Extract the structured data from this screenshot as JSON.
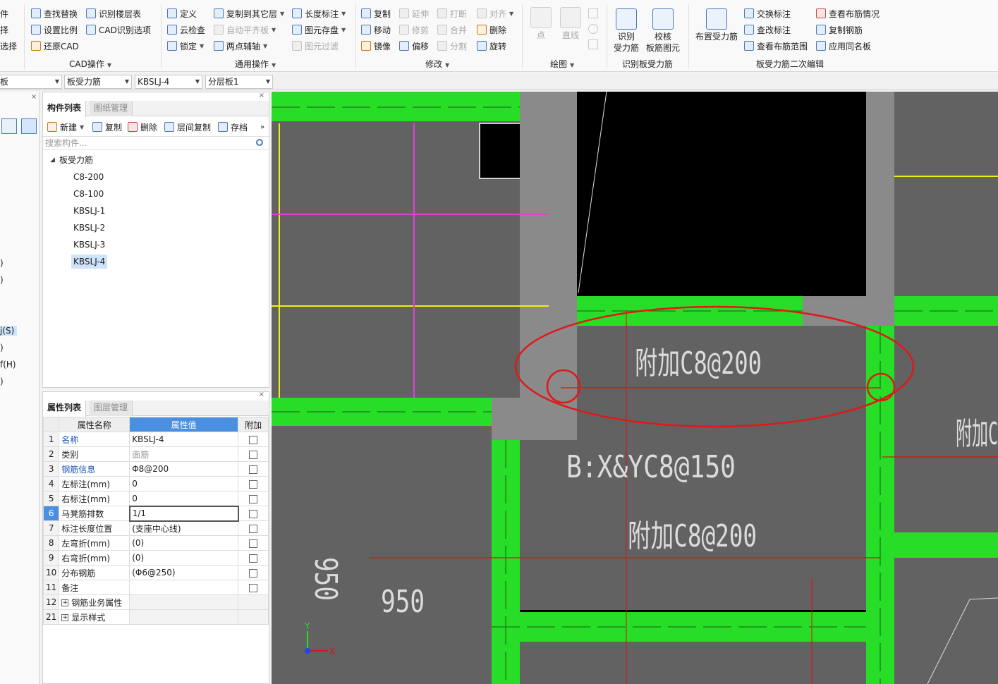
{
  "ribbon": {
    "cad": {
      "label": "CAD操作",
      "find_replace": "查找替换",
      "recognize_floor_table": "识别楼层表",
      "set_scale": "设置比例",
      "cad_options": "CAD识别选项",
      "restore_cad": "还原CAD"
    },
    "general": {
      "label": "通用操作",
      "define": "定义",
      "copy_to_other_floor": "复制到其它层",
      "length_mark": "长度标注",
      "cloud_check": "云检查",
      "auto_flat_slab": "自动平齐板",
      "element_save": "图元存盘",
      "lock": "锁定",
      "two_point_axis": "两点辅轴",
      "element_filter": "图元过滤"
    },
    "modify": {
      "label": "修改",
      "copy": "复制",
      "extend": "延伸",
      "break": "打断",
      "align": "对齐",
      "move": "移动",
      "trim": "修剪",
      "merge": "合并",
      "delete": "删除",
      "mirror": "镜像",
      "offset": "偏移",
      "split": "分割",
      "rotate": "旋转"
    },
    "draw": {
      "label": "绘图",
      "point": "点",
      "line": "直线"
    },
    "recognize": {
      "label": "识别板受力筋",
      "recognize_rebar_1": "识别",
      "recognize_rebar_2": "受力筋",
      "check_slab_1": "校核",
      "check_slab_2": "板筋图元"
    },
    "secondary": {
      "label": "板受力筋二次编辑",
      "place_rebar": "布置受力筋",
      "swap_mark": "交换标注",
      "view_layout": "查看布筋情况",
      "view_mark": "查改标注",
      "copy_rebar": "复制钢筋",
      "view_range": "查看布筋范围",
      "apply_same_name": "应用同名板"
    },
    "left_cut": [
      "件",
      "择",
      "选择"
    ]
  },
  "selectors": {
    "s0": "板",
    "s1": "板受力筋",
    "s2": "KBSLJ-4",
    "s3": "分层板1"
  },
  "leftnav": {
    "items": [
      ")",
      ")",
      "j(S)",
      ")",
      "f(H)",
      ")"
    ]
  },
  "components": {
    "tabs": {
      "list": "构件列表",
      "drawings": "图纸管理"
    },
    "toolbar": {
      "new": "新建",
      "copy": "复制",
      "delete": "删除",
      "floor_copy": "层间复制",
      "archive": "存档"
    },
    "search_placeholder": "搜索构件...",
    "tree": {
      "root": "板受力筋",
      "items": [
        "C8-200",
        "C8-100",
        "KBSLJ-1",
        "KBSLJ-2",
        "KBSLJ-3",
        "KBSLJ-4"
      ]
    }
  },
  "properties": {
    "tabs": {
      "list": "属性列表",
      "layers": "图层管理"
    },
    "headers": {
      "name": "属性名称",
      "value": "属性值",
      "extra": "附加"
    },
    "rows": [
      {
        "no": "1",
        "name": "名称",
        "value": "KBSLJ-4"
      },
      {
        "no": "2",
        "name": "类别",
        "value": "面筋"
      },
      {
        "no": "3",
        "name": "钢筋信息",
        "value": "Φ8@200"
      },
      {
        "no": "4",
        "name": "左标注(mm)",
        "value": "0"
      },
      {
        "no": "5",
        "name": "右标注(mm)",
        "value": "0"
      },
      {
        "no": "6",
        "name": "马凳筋排数",
        "value": "1/1"
      },
      {
        "no": "7",
        "name": "标注长度位置",
        "value": "(支座中心线)"
      },
      {
        "no": "8",
        "name": "左弯折(mm)",
        "value": "(0)"
      },
      {
        "no": "9",
        "name": "右弯折(mm)",
        "value": "(0)"
      },
      {
        "no": "10",
        "name": "分布钢筋",
        "value": "(Φ6@250)"
      },
      {
        "no": "11",
        "name": "备注",
        "value": ""
      },
      {
        "no": "12",
        "name": "钢筋业务属性",
        "value": ""
      },
      {
        "no": "21",
        "name": "显示样式",
        "value": ""
      }
    ]
  },
  "canvas": {
    "text1": "附加C8@200",
    "text2": "B:X&YC8@150",
    "text3": "附加C8@200",
    "dim_v": "950",
    "dim_h": "950",
    "text_right": "附加C",
    "axis_x": "X",
    "axis_y": "Y",
    "colors": {
      "slab": "#626262",
      "beam": "#28dd28",
      "wall": "#8a8a8a",
      "rebar": "#e01010",
      "yellow": "#f0f010",
      "magenta": "#e040e0",
      "highlight": "#e01818"
    }
  }
}
